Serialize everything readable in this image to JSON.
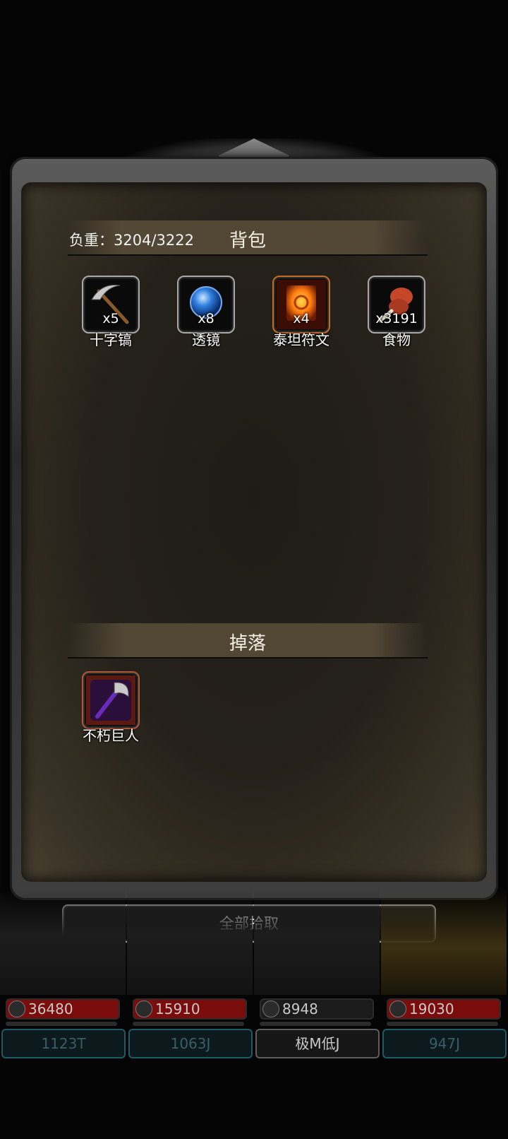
{
  "backpack": {
    "title": "背包",
    "weight_label": "负重：3204/3222",
    "items": [
      {
        "name": "十字镐",
        "count": "x5",
        "icon": "pickaxe-icon"
      },
      {
        "name": "透镜",
        "count": "x8",
        "icon": "lens-icon"
      },
      {
        "name": "泰坦符文",
        "count": "x4",
        "icon": "titan-rune-icon"
      },
      {
        "name": "食物",
        "count": "x3191",
        "icon": "food-icon"
      }
    ]
  },
  "drops": {
    "title": "掉落",
    "items": [
      {
        "name": "不朽巨人",
        "icon": "immortal-giant-axe-icon"
      }
    ]
  },
  "pickup_all_label": "全部拾取",
  "heroes": [
    {
      "hp": "36480",
      "power": "1123T"
    },
    {
      "hp": "15910",
      "power": "1063J"
    },
    {
      "hp": "8948",
      "power": "极M低J"
    },
    {
      "hp": "19030",
      "power": "947J"
    }
  ],
  "colors": {
    "hp_bar": "#7b0c0c",
    "panel_bg": "#25211a",
    "power_border": "#1f5b66"
  }
}
